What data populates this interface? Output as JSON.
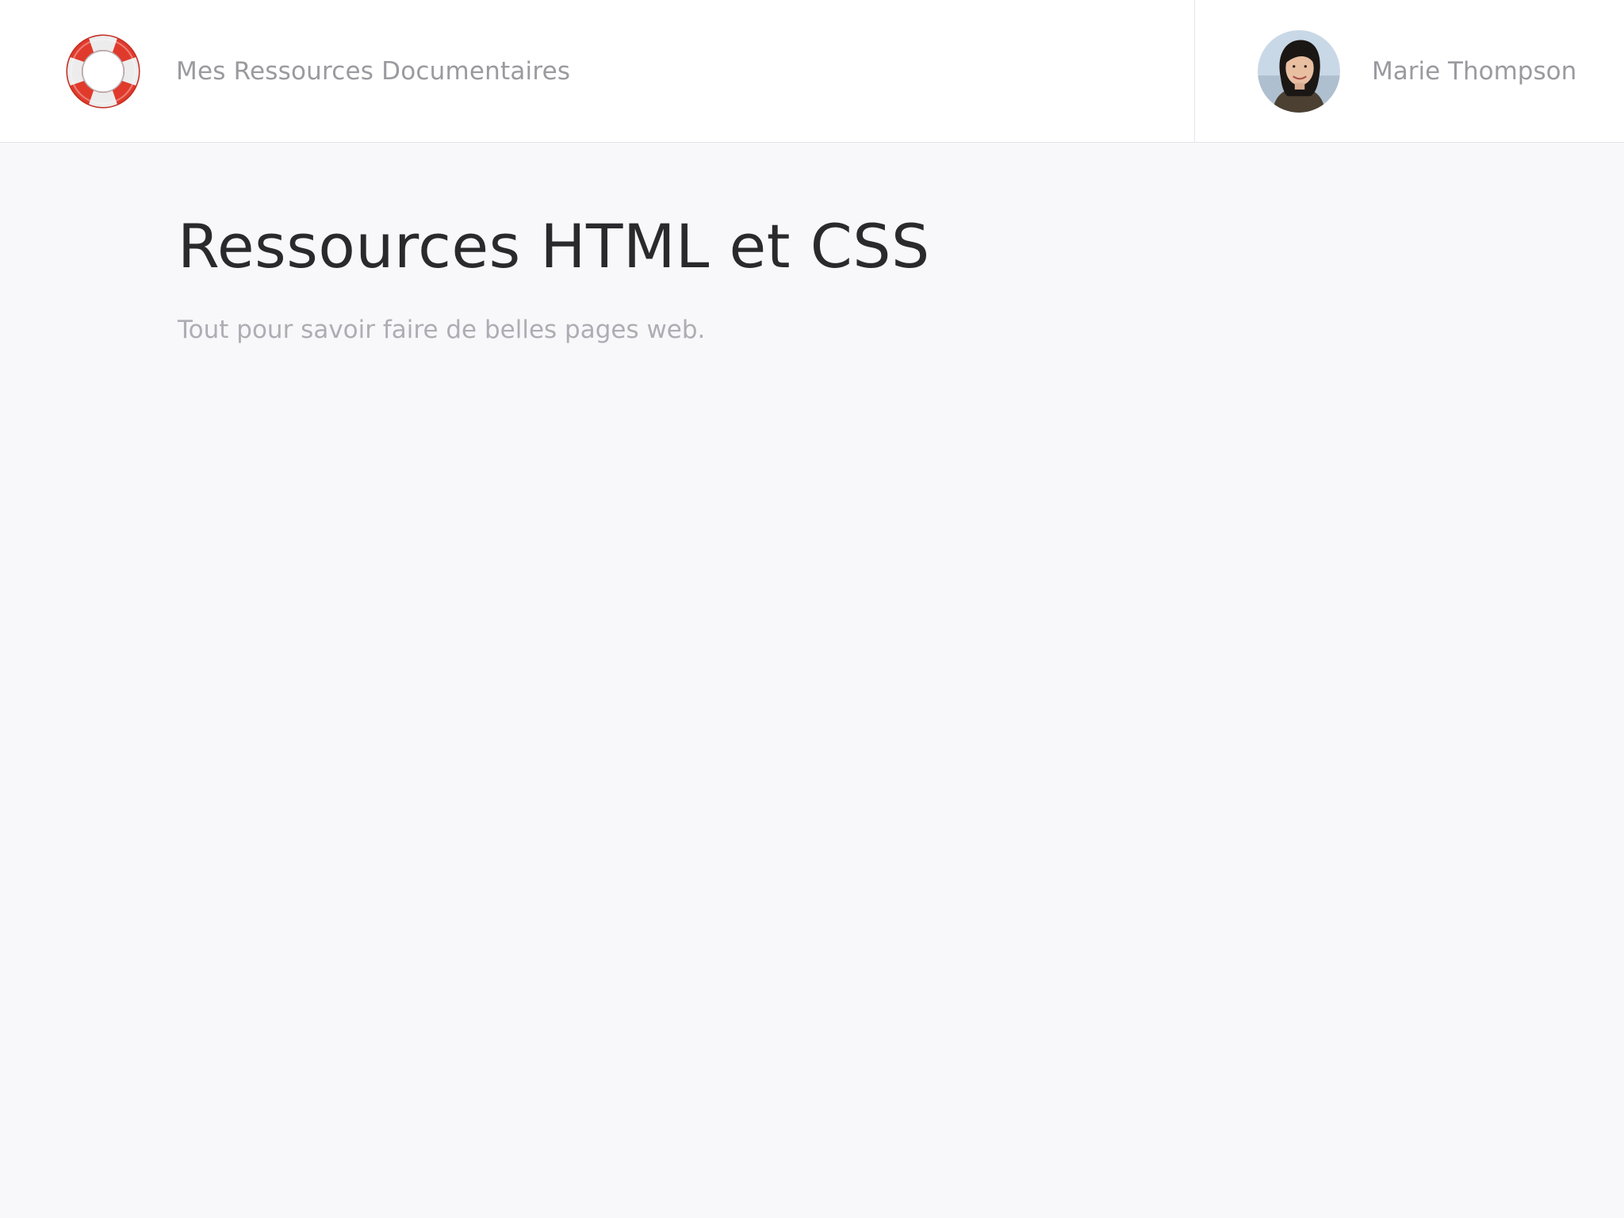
{
  "header": {
    "logo_icon": "lifebuoy-icon",
    "brand_name": "Mes Ressources Documentaires",
    "user": {
      "name": "Marie Thompson",
      "avatar_icon": "user-avatar"
    }
  },
  "main": {
    "title": "Ressources HTML et CSS",
    "subtitle": "Tout pour savoir faire de belles pages web."
  },
  "colors": {
    "background": "#f8f7fa",
    "header_background": "#ffffff",
    "lifebuoy_red": "#e03a2c",
    "lifebuoy_white": "#eeeeee",
    "title_text": "#2a2a2d",
    "muted_text": "#9a9a9f"
  }
}
